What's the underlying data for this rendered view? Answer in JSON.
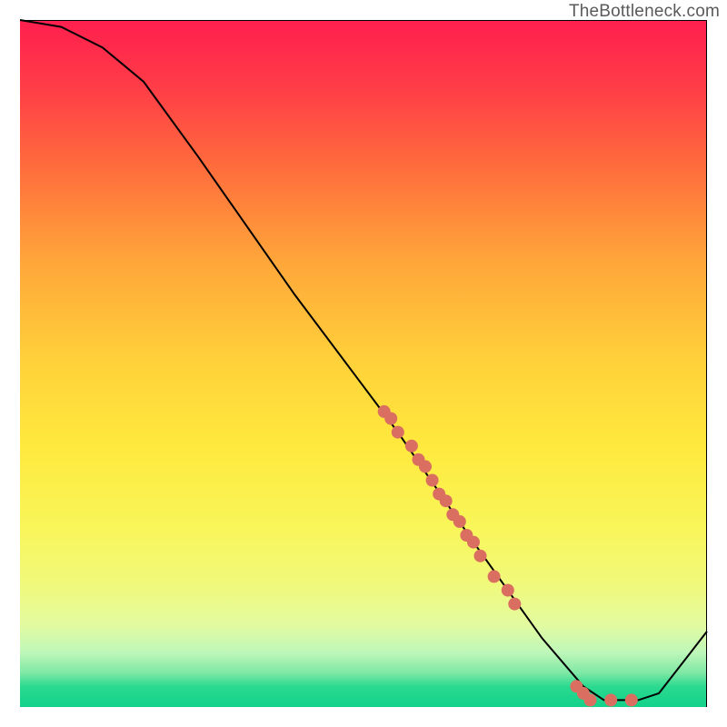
{
  "watermark": "TheBottleneck.com",
  "chart_data": {
    "type": "line",
    "title": "",
    "xlabel": "",
    "ylabel": "",
    "xlim": [
      0,
      100
    ],
    "ylim": [
      0,
      100
    ],
    "curve": [
      {
        "x": 0,
        "y": 100
      },
      {
        "x": 6,
        "y": 99
      },
      {
        "x": 12,
        "y": 96
      },
      {
        "x": 18,
        "y": 91
      },
      {
        "x": 26,
        "y": 80
      },
      {
        "x": 40,
        "y": 60
      },
      {
        "x": 55,
        "y": 40
      },
      {
        "x": 66,
        "y": 24
      },
      {
        "x": 76,
        "y": 10
      },
      {
        "x": 82,
        "y": 3
      },
      {
        "x": 85,
        "y": 1
      },
      {
        "x": 90,
        "y": 1
      },
      {
        "x": 93,
        "y": 2
      },
      {
        "x": 100,
        "y": 11
      }
    ],
    "scatter_points": [
      {
        "x": 53,
        "y": 43
      },
      {
        "x": 54,
        "y": 42
      },
      {
        "x": 55,
        "y": 40
      },
      {
        "x": 57,
        "y": 38
      },
      {
        "x": 58,
        "y": 36
      },
      {
        "x": 59,
        "y": 35
      },
      {
        "x": 60,
        "y": 33
      },
      {
        "x": 61,
        "y": 31
      },
      {
        "x": 62,
        "y": 30
      },
      {
        "x": 63,
        "y": 28
      },
      {
        "x": 64,
        "y": 27
      },
      {
        "x": 65,
        "y": 25
      },
      {
        "x": 66,
        "y": 24
      },
      {
        "x": 67,
        "y": 22
      },
      {
        "x": 69,
        "y": 19
      },
      {
        "x": 71,
        "y": 17
      },
      {
        "x": 72,
        "y": 15
      },
      {
        "x": 81,
        "y": 3
      },
      {
        "x": 82,
        "y": 2
      },
      {
        "x": 83,
        "y": 1
      },
      {
        "x": 86,
        "y": 1
      },
      {
        "x": 89,
        "y": 1
      }
    ],
    "colors": {
      "curve": "#000000",
      "points": "#da6e61",
      "gradient_top": "#ff1f4e",
      "gradient_mid": "#ffe03a",
      "gradient_bottom": "#12d28a"
    }
  }
}
